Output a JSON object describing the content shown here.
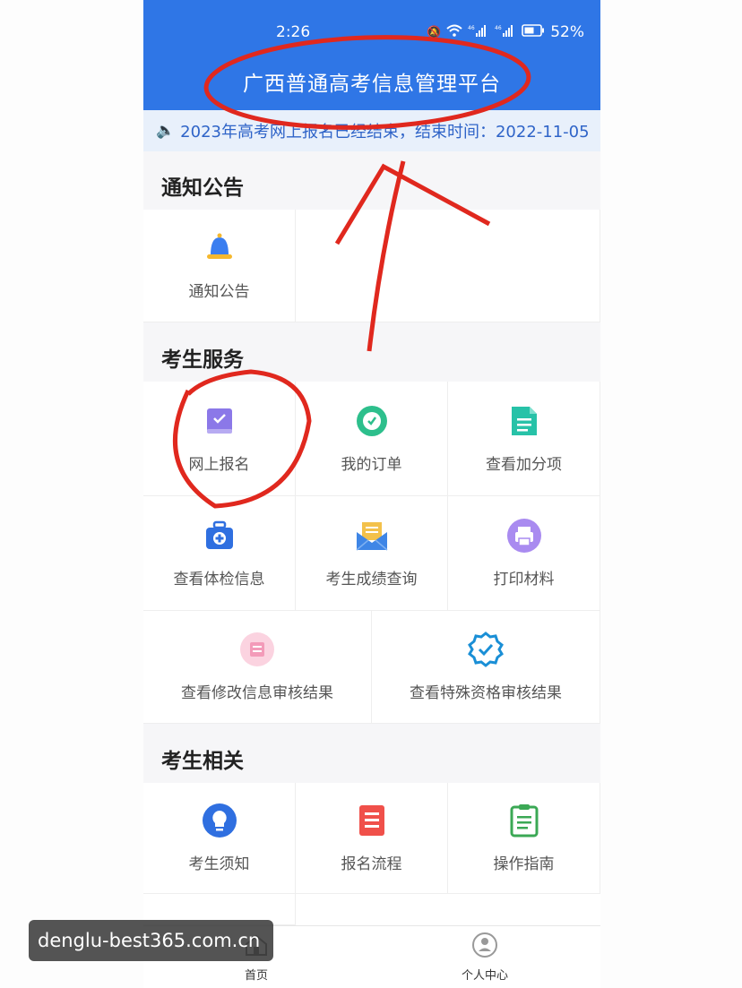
{
  "status": {
    "time": "2:26",
    "battery": "52%",
    "sig1": "46",
    "sig2": "46"
  },
  "header": {
    "title": "广西普通高考信息管理平台"
  },
  "notice": {
    "text": "2023年高考网上报名已经结束，结束时间：2022-11-05"
  },
  "sections": {
    "notices": {
      "title": "通知公告",
      "items": [
        {
          "label": "通知公告",
          "icon": "bell-icon"
        }
      ]
    },
    "services": {
      "title": "考生服务",
      "items": [
        {
          "label": "网上报名",
          "icon": "registration-book-icon"
        },
        {
          "label": "我的订单",
          "icon": "order-clock-icon"
        },
        {
          "label": "查看加分项",
          "icon": "document-list-icon"
        },
        {
          "label": "查看体检信息",
          "icon": "medical-kit-icon"
        },
        {
          "label": "考生成绩查询",
          "icon": "envelope-letter-icon"
        },
        {
          "label": "打印材料",
          "icon": "printer-icon"
        },
        {
          "label": "查看修改信息审核结果",
          "icon": "edit-review-icon"
        },
        {
          "label": "查看特殊资格审核结果",
          "icon": "verified-badge-icon"
        }
      ]
    },
    "related": {
      "title": "考生相关",
      "items": [
        {
          "label": "考生须知",
          "icon": "lightbulb-icon"
        },
        {
          "label": "报名流程",
          "icon": "process-doc-icon"
        },
        {
          "label": "操作指南",
          "icon": "clipboard-guide-icon"
        }
      ]
    }
  },
  "tabbar": {
    "home": "首页",
    "profile": "个人中心"
  },
  "watermark": "denglu-best365.com.cn",
  "colors": {
    "header": "#2f76e6",
    "annotation": "#e0281e",
    "notice_text": "#2f64c8"
  }
}
